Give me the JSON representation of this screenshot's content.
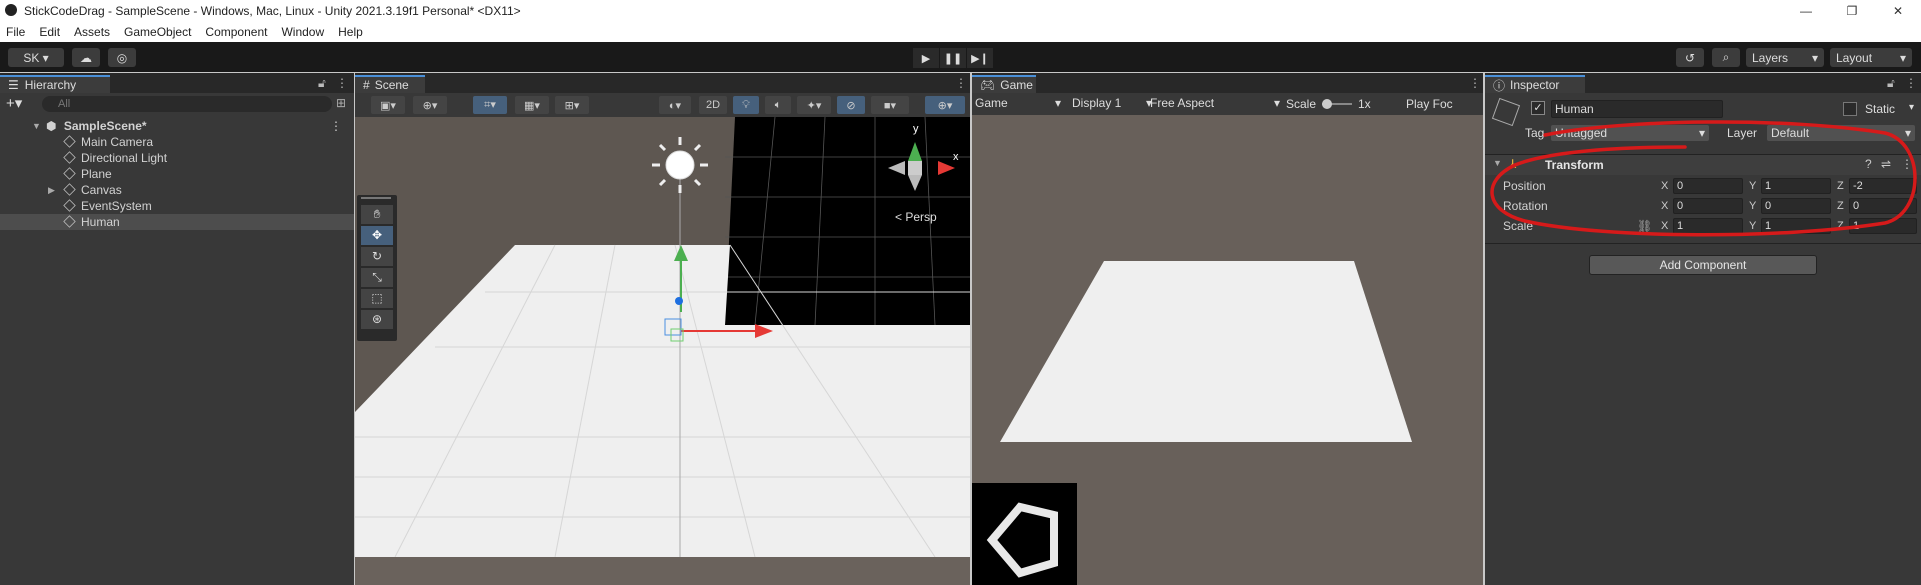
{
  "window": {
    "title": "StickCodeDrag - SampleScene - Windows, Mac, Linux - Unity 2021.3.19f1 Personal* <DX11>",
    "controls": [
      "—",
      "❐",
      "✕"
    ]
  },
  "menu": [
    "File",
    "Edit",
    "Assets",
    "GameObject",
    "Component",
    "Window",
    "Help"
  ],
  "toolbar": {
    "account": "SK ▾",
    "layers": "Layers",
    "layout": "Layout"
  },
  "hierarchy": {
    "tab": "Hierarchy",
    "search_placeholder": "All",
    "scene": "SampleScene*",
    "items": [
      "Main Camera",
      "Directional Light",
      "Plane",
      "Canvas",
      "EventSystem",
      "Human"
    ]
  },
  "scene": {
    "tab": "Scene",
    "mode_2d": "2D",
    "persp": "< Persp",
    "gizmo_y": "y",
    "gizmo_x": "x"
  },
  "game": {
    "tab": "Game",
    "mode": "Game",
    "display": "Display 1",
    "aspect": "Free Aspect",
    "scale_label": "Scale",
    "scale_value": "1x",
    "play_focus": "Play Foc"
  },
  "inspector": {
    "tab": "Inspector",
    "object_name": "Human",
    "static": "Static",
    "tag_label": "Tag",
    "tag_value": "Untagged",
    "layer_label": "Layer",
    "layer_value": "Default",
    "component": "Transform",
    "position_label": "Position",
    "rotation_label": "Rotation",
    "scale_label": "Scale",
    "position": {
      "x": "0",
      "y": "1",
      "z": "-2"
    },
    "rotation": {
      "x": "0",
      "y": "0",
      "z": "0"
    },
    "scale": {
      "x": "1",
      "y": "1",
      "z": "1"
    },
    "add_component": "Add Component",
    "axis_x": "X",
    "axis_y": "Y",
    "axis_z": "Z"
  },
  "colors": {
    "accent": "#4a90d9",
    "annotation": "#d61a1a"
  }
}
